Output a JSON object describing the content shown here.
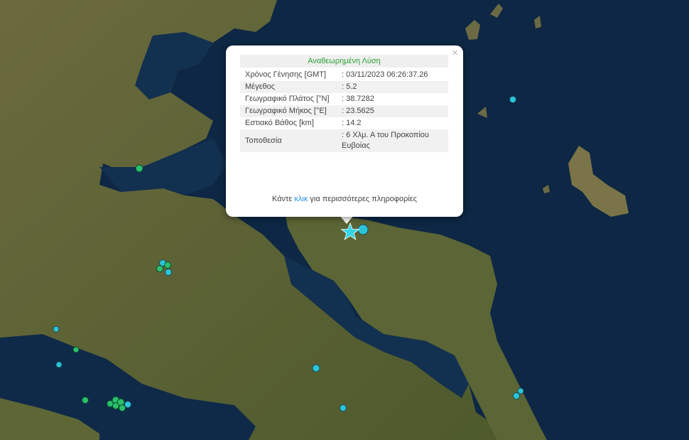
{
  "popup": {
    "title": "Αναθεωρημένη Λύση",
    "close_symbol": "×",
    "rows": [
      {
        "label": "Χρόνος Γένησης [GMT]",
        "value": ": 03/11/2023 06:26:37.26"
      },
      {
        "label": "Μέγεθος",
        "value": ": 5.2"
      },
      {
        "label": "Γεωγραφικό Πλάτος [°N]",
        "value": ": 38.7282"
      },
      {
        "label": "Γεωγραφικό Μήκος [°E]",
        "value": ": 23.5625"
      },
      {
        "label": "Εστιακό Βάθος [km]",
        "value": ": 14.2"
      },
      {
        "label": "Τοποθεσία",
        "value": ": 6 Χλμ. Α του Προκοπίου Ευβοίας"
      }
    ],
    "more_prefix": "Κάντε",
    "more_link": "κλικ",
    "more_suffix": "για περισσότερες πληροφορίες"
  },
  "colors": {
    "sea": "#0d2744",
    "land": "#5b6636",
    "epicenter_star": "#36d6e8",
    "quake_cyan": "#2cc5d8",
    "quake_green": "#2bbf6c",
    "title_green": "#2aa032",
    "link_blue": "#1f8fe6"
  },
  "map": {
    "main_event_icon": "star-icon",
    "marker_icon": "circle-icon"
  }
}
